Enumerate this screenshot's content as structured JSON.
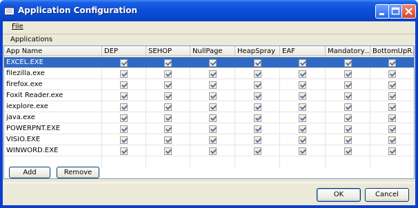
{
  "window": {
    "title": "Application Configuration"
  },
  "menu": {
    "file": "File"
  },
  "group": {
    "label": "Applications"
  },
  "columns": [
    "App Name",
    "DEP",
    "SEHOP",
    "NullPage",
    "HeapSpray",
    "EAF",
    "Mandatory…",
    "BottomUpR…"
  ],
  "rows": [
    {
      "name": "EXCEL.EXE",
      "selected": true
    },
    {
      "name": "filezilla.exe",
      "selected": false
    },
    {
      "name": "firefox.exe",
      "selected": false
    },
    {
      "name": "Foxit Reader.exe",
      "selected": false
    },
    {
      "name": "iexplore.exe",
      "selected": false
    },
    {
      "name": "java.exe",
      "selected": false
    },
    {
      "name": "POWERPNT.EXE",
      "selected": false
    },
    {
      "name": "VISIO.EXE",
      "selected": false
    },
    {
      "name": "WINWORD.EXE",
      "selected": false
    }
  ],
  "checked": true,
  "buttons": {
    "add": "Add",
    "remove": "Remove",
    "ok": "OK",
    "cancel": "Cancel"
  },
  "colors": {
    "titlebar": "#0b4fd8",
    "selection": "#316ac5",
    "dialog": "#ece9d8"
  }
}
